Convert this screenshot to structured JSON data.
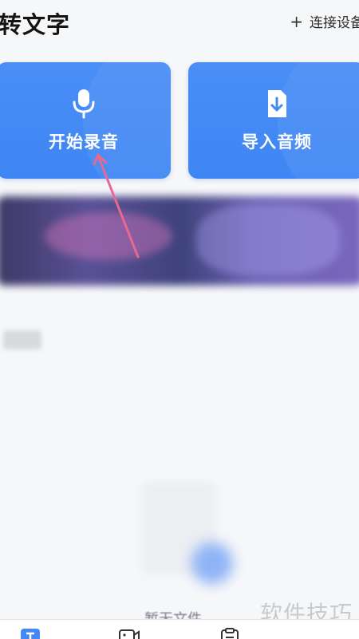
{
  "header": {
    "title": "转文字",
    "connect_icon": "+",
    "connect_label": "连接设备"
  },
  "actions": {
    "record": {
      "label": "开始录音",
      "icon": "microphone-icon"
    },
    "import": {
      "label": "导入音频",
      "icon": "file-download-icon"
    }
  },
  "empty_state": {
    "text": "暂无文件"
  },
  "tabbar": {
    "icons": [
      "text-icon",
      "video-icon",
      "notes-icon"
    ]
  },
  "watermark": "软件技巧",
  "colors": {
    "accent": "#4389f5",
    "annotation_arrow": "#e8698f"
  }
}
